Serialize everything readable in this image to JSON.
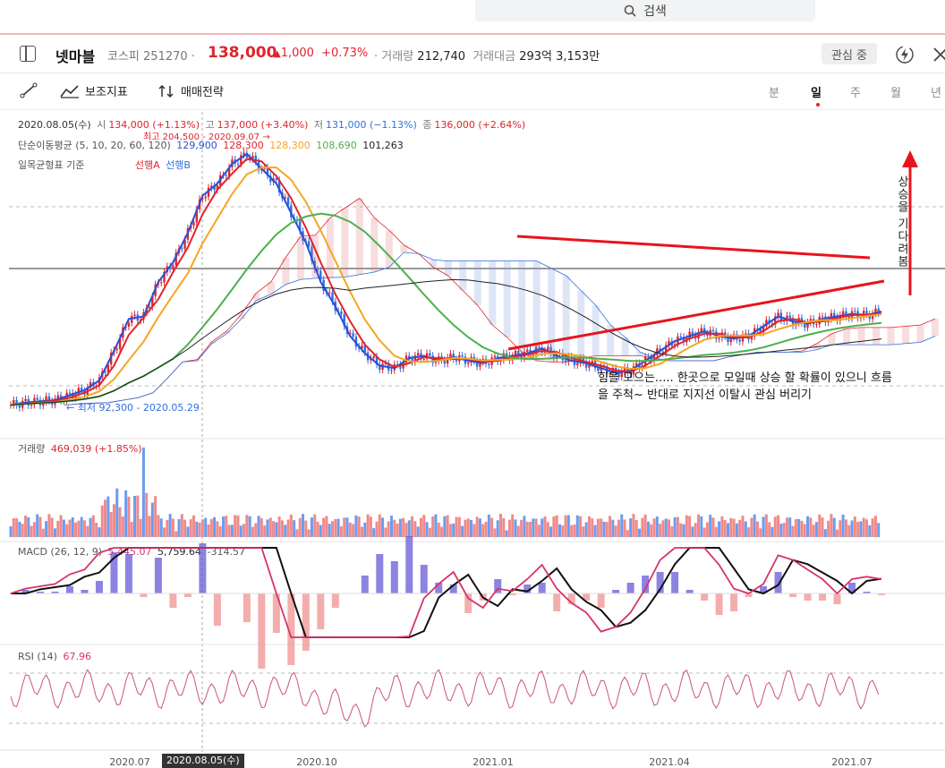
{
  "search": {
    "label": "검색",
    "icon": "search-icon"
  },
  "stock": {
    "name": "넷마블",
    "market": "코스피",
    "code": "251270",
    "price": "138,000",
    "change": "1,000",
    "change_pct": "+0.73%",
    "volume_label": "거래량",
    "volume": "212,740",
    "amount_label": "거래대금",
    "amount": "293억 3,153만",
    "watch_label": "관심 중",
    "up_color": "#e0242c",
    "down_color": "#2f6fe0"
  },
  "toolbar": {
    "draw_icon": "draw-line-icon",
    "indicator_label": "보조지표",
    "strategy_label": "매매전략",
    "periods": [
      "분",
      "일",
      "주",
      "월",
      "년"
    ],
    "active_period": "일"
  },
  "legend": {
    "ohlc_date": "2020.08.05(수)",
    "open_label": "시",
    "open": "134,000 (+1.13%)",
    "high_label": "고",
    "high": "137,000 (+3.40%)",
    "low_label": "저",
    "low": "131,000 (−1.13%)",
    "close_label": "종",
    "close": "136,000 (+2.64%)",
    "ma_label": "단순이동평균 (5, 10, 20, 60, 120)",
    "ma_values": [
      "129,900",
      "128,300",
      "128,300",
      "108,690",
      "101,263"
    ],
    "ma_colors": [
      "#2a4fd6",
      "#e0242c",
      "#f5a623",
      "#4caf50",
      "#222222"
    ],
    "ichimoku_label": "일목균형표 기준",
    "span_a_label": "선행A",
    "span_b_label": "선행B",
    "high_marker": "최고 204,500 - 2020.09.07 →",
    "low_marker": "← 최저 92,300 - 2020.05.29",
    "volume_legend_label": "거래량",
    "volume_legend_value": "469,039 (+1.85%)",
    "macd_label": "MACD (26, 12, 9)",
    "macd_values": [
      "5,445.07",
      "5,759.64",
      "-314.57"
    ],
    "rsi_label": "RSI (14)",
    "rsi_value": "67.96"
  },
  "annotation": {
    "text": "힘을 모으는.....  한곳으로 모일때  상승 할 확률이 있으니 흐름을 주척~   반대로  지지선 이탈시 관심 버리기",
    "vertical_text": "상승을 기다려봄"
  },
  "xaxis": {
    "ticks": [
      "2020.07",
      "2020.10",
      "2021.01",
      "2021.04",
      "2021.07"
    ],
    "current": "2020.08.05(수)"
  },
  "chart_data": {
    "type": "line",
    "title": "",
    "x_ticks": [
      "2020.07",
      "2020.10",
      "2021.01",
      "2021.04",
      "2021.07"
    ],
    "price_range": [
      90000,
      210000
    ],
    "price_series": [
      {
        "name": "종가",
        "values": [
          100000,
          101000,
          101500,
          102000,
          104000,
          106000,
          110000,
          122000,
          135000,
          136000,
          150000,
          158000,
          170000,
          185000,
          190000,
          198000,
          202000,
          196000,
          190000,
          178000,
          166000,
          150000,
          140000,
          128000,
          121000,
          116000,
          115000,
          119000,
          120000,
          118000,
          119500,
          118000,
          117000,
          119000,
          120000,
          121000,
          123000,
          120000,
          118000,
          117000,
          115000,
          113000,
          114000,
          118000,
          122000,
          126000,
          128000,
          130000,
          128000,
          127000,
          128000,
          132000,
          136000,
          134000,
          133000,
          135000,
          136000,
          137000,
          136500,
          138000
        ]
      }
    ],
    "annotation_high": {
      "label": "최고 204,500 - 2020.09.07"
    },
    "annotation_low": {
      "label": "최저 92,300 - 2020.05.29"
    },
    "volume": {
      "last": 469039
    },
    "macd": {
      "macd": 5445.07,
      "signal": 5759.64,
      "histogram": -314.57
    },
    "rsi": {
      "last": 67.96,
      "levels": [
        30,
        70
      ]
    }
  }
}
